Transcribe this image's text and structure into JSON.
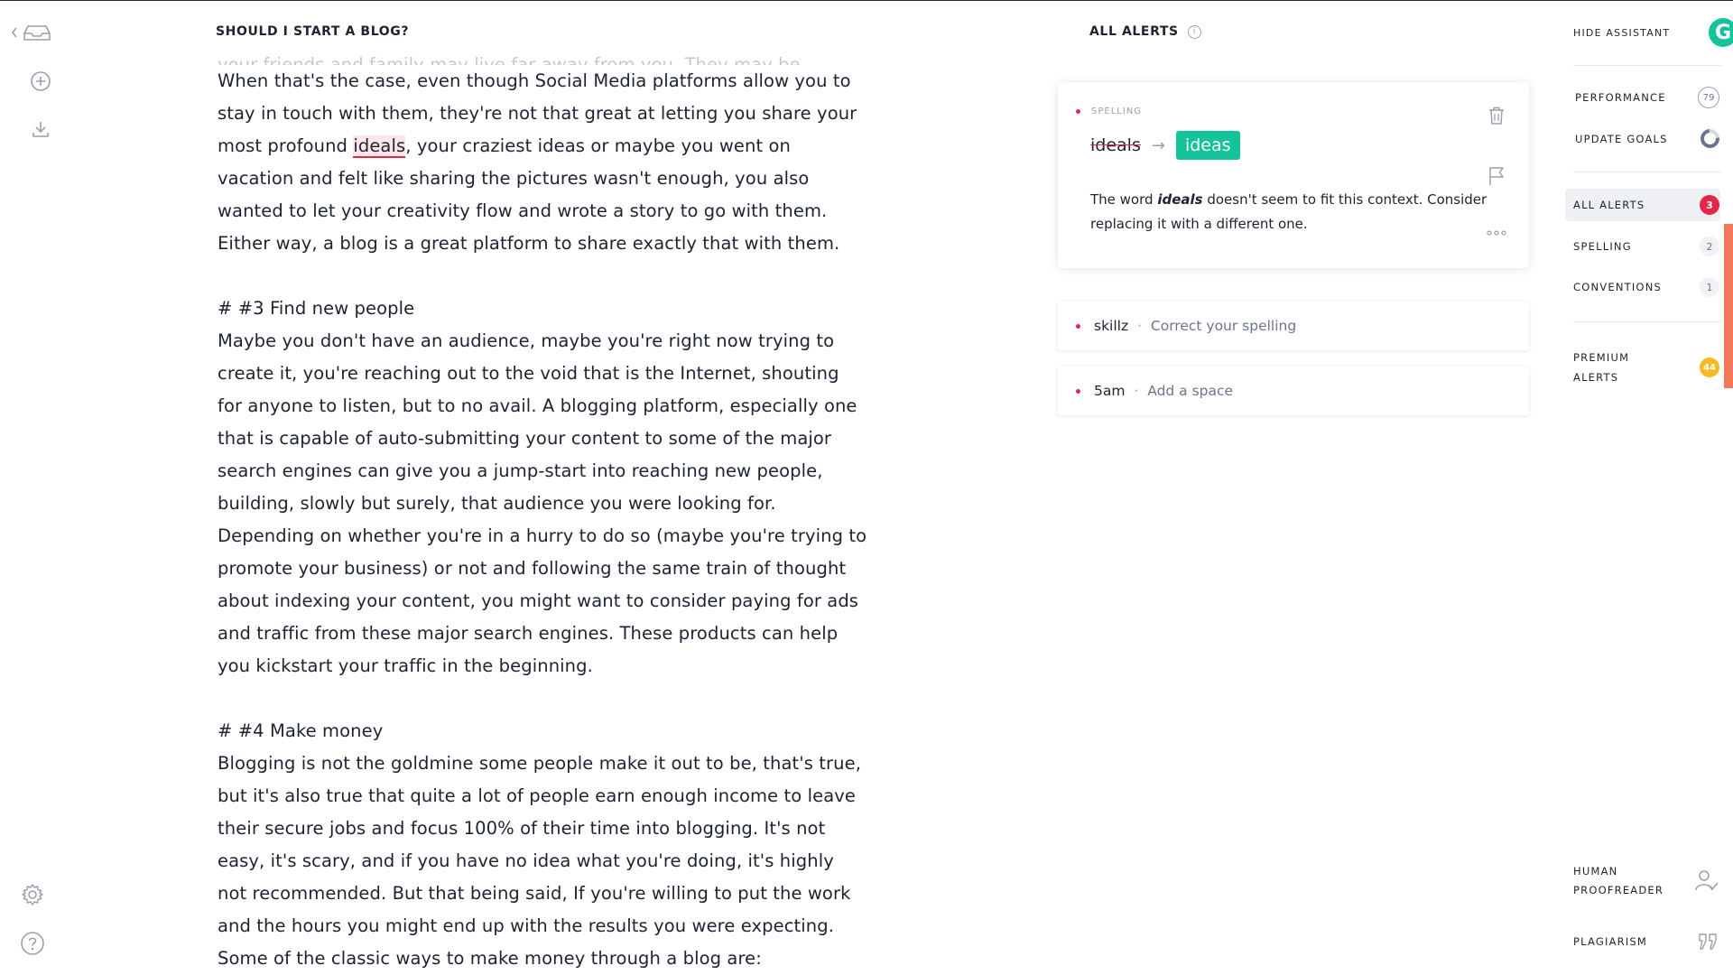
{
  "document": {
    "title": "SHOULD I START A BLOG?",
    "faded_line": "your friends and family may live far away from you. They may be",
    "paragraphs": [
      {
        "type": "text",
        "segments": [
          {
            "text": "When that's the case, even though Social Media platforms allow you to stay in touch with them, they're not that great at letting you share your most profound "
          },
          {
            "text": "ideals",
            "misspelled": true
          },
          {
            "text": ", your craziest ideas or maybe you went on vacation and felt like sharing the pictures wasn't enough, you also wanted to let your creativity flow and wrote a story to go with them. Either way, a blog is a great platform to share exactly that with them."
          }
        ]
      },
      {
        "type": "gap"
      },
      {
        "type": "text",
        "segments": [
          {
            "text": "# #3 Find new people"
          }
        ]
      },
      {
        "type": "text",
        "segments": [
          {
            "text": "Maybe you don't have an audience, maybe you're right now trying to create it, you're reaching out to the void that is the Internet, shouting for anyone to listen, but to no avail. A blogging platform, especially one that is capable of auto-submitting your content to some of the major search engines can give you a jump-start into reaching new people, building, slowly but surely, that audience you were looking for. Depending on whether you're in a hurry to do so (maybe you're trying to promote your business) or not and following the same train of thought about indexing your content, you might want to consider paying for ads and traffic from these major search engines. These products can help you kickstart your traffic in the beginning."
          }
        ]
      },
      {
        "type": "gap"
      },
      {
        "type": "text",
        "segments": [
          {
            "text": "# #4 Make money"
          }
        ]
      },
      {
        "type": "text",
        "segments": [
          {
            "text": "Blogging is not the goldmine some people make it out to be, that's true, but it's also true that quite a lot of people earn enough income to leave their secure jobs and focus 100% of their time into blogging. It's not easy, it's scary, and if you have no idea what you're doing, it's highly not recommended. But that being said, If you're willing to put the work and the hours you might end up with the results you were expecting."
          }
        ]
      },
      {
        "type": "text",
        "segments": [
          {
            "text": "Some of the classic ways to make money through a blog are:"
          }
        ]
      }
    ]
  },
  "alerts_panel": {
    "title": "ALL ALERTS",
    "expanded_card": {
      "category": "SPELLING",
      "original": "ideals",
      "suggestion": "ideas",
      "explanation_pre": "The word ",
      "explanation_word": "ideals",
      "explanation_post": " doesn't seem to fit this context. Consider replacing it with a different one."
    },
    "collapsed_cards": [
      {
        "word": "skillz",
        "hint": "Correct your spelling"
      },
      {
        "word": "5am",
        "hint": "Add a space"
      }
    ]
  },
  "assistant": {
    "hide_label": "HIDE ASSISTANT",
    "logo_letter": "G",
    "performance_label": "PERFORMANCE",
    "performance_score": "79",
    "goals_label": "UPDATE GOALS",
    "filters": [
      {
        "label": "ALL ALERTS",
        "count": "3"
      },
      {
        "label": "SPELLING",
        "count": "2"
      },
      {
        "label": "CONVENTIONS",
        "count": "1"
      }
    ],
    "premium_line1": "PREMIUM",
    "premium_line2": "ALERTS",
    "premium_count": "44",
    "proofreader_line1": "HUMAN",
    "proofreader_line2": "PROOFREADER",
    "plagiarism_label": "PLAGIARISM"
  },
  "colors": {
    "accent_green": "#15c39a",
    "alert_red": "#e32749",
    "premium_yellow": "#f9b923",
    "scroll_orange": "#f2785c"
  }
}
